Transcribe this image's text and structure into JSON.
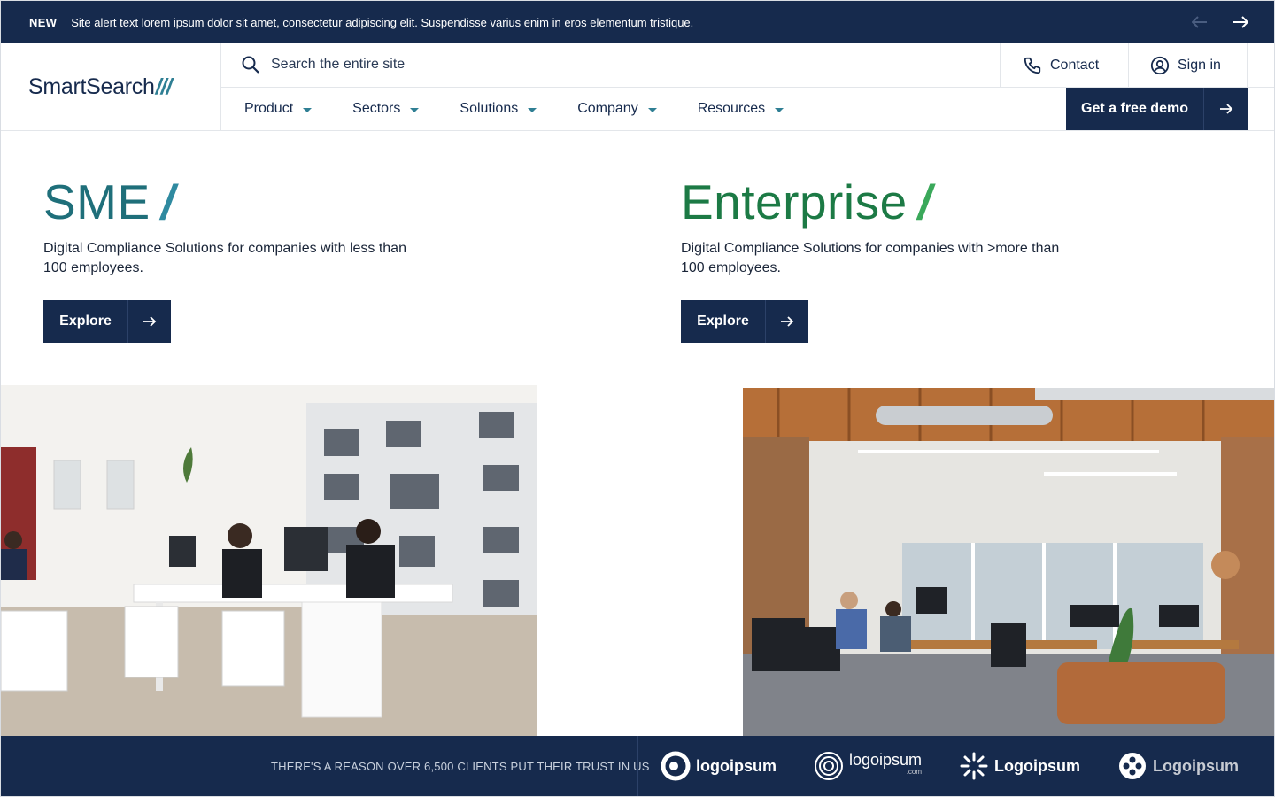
{
  "alert": {
    "badge": "NEW",
    "text": "Site alert text lorem ipsum dolor sit amet, consectetur adipiscing elit. Suspendisse varius enim in eros elementum tristique."
  },
  "brand": {
    "name": "SmartSearch",
    "slashes": "///"
  },
  "search": {
    "placeholder": "Search the entire site"
  },
  "utility": {
    "contact": "Contact",
    "signin": "Sign in"
  },
  "nav": {
    "items": [
      {
        "label": "Product"
      },
      {
        "label": "Sectors"
      },
      {
        "label": "Solutions"
      },
      {
        "label": "Company"
      },
      {
        "label": "Resources"
      }
    ],
    "cta": "Get a free demo"
  },
  "sme": {
    "title": "SME",
    "slash": "/",
    "description": "Digital Compliance Solutions for companies with less than 100 employees.",
    "button": "Explore"
  },
  "enterprise": {
    "title": "Enterprise",
    "slash": "/",
    "description": "Digital Compliance Solutions for companies with >more than 100 employees.",
    "button": "Explore"
  },
  "trust": {
    "tagline": "THERE'S A REASON OVER 6,500 CLIENTS PUT THEIR TRUST IN US",
    "logos": [
      "logoipsum",
      "logoipsum",
      "Logoipsum",
      "Logoipsum"
    ],
    "logo_sub": ".com"
  },
  "colors": {
    "navy": "#162a4d",
    "teal": "#2f7f94",
    "green": "#1c7a45"
  }
}
